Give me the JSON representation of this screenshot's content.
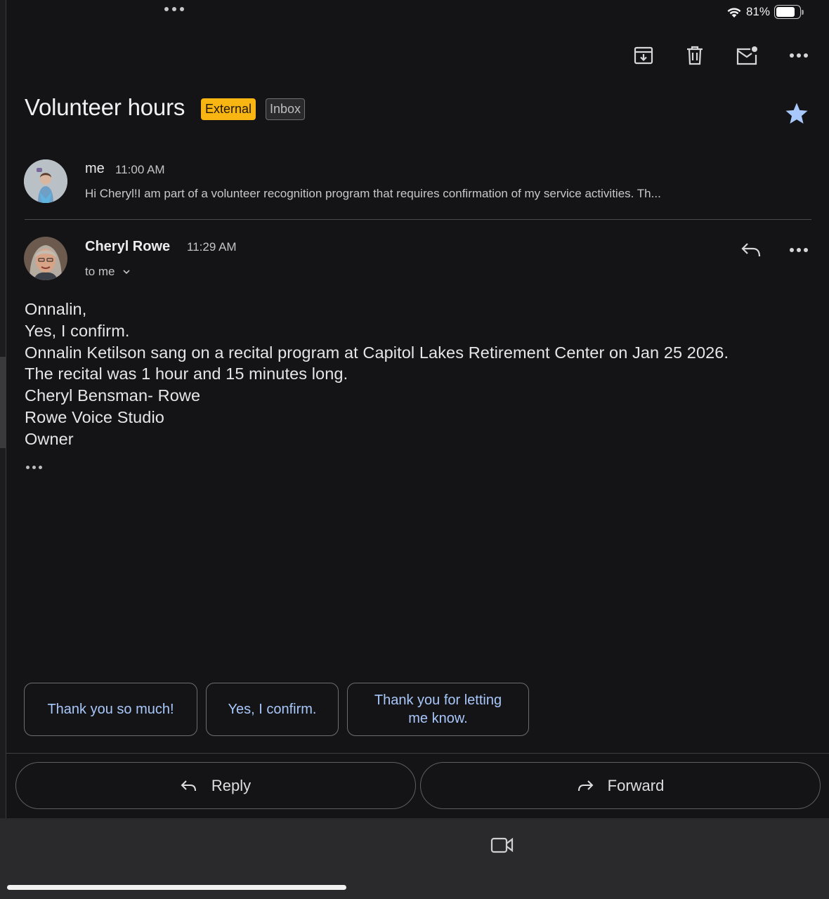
{
  "status": {
    "battery": "81%",
    "battery_level": 0.81
  },
  "toolbar": {
    "archive_icon": "archive-icon",
    "delete_icon": "trash-icon",
    "unread_icon": "mark-unread-icon",
    "more_icon": "more-horizontal-icon"
  },
  "thread": {
    "subject": "Volunteer hours",
    "labels": [
      "External",
      "Inbox"
    ],
    "starred": true
  },
  "messages": [
    {
      "sender": "me",
      "time": "11:00 AM",
      "snippet": "Hi Cheryl!I am part of a volunteer recognition program that requires confirmation of my service activities. Th..."
    },
    {
      "sender": "Cheryl Rowe",
      "time": "11:29 AM",
      "to": "to me",
      "body": [
        "Onnalin,",
        "Yes, I confirm.",
        "Onnalin Ketilson sang on a recital program at Capitol Lakes Retirement Center on Jan 25 2026.",
        "The recital was 1 hour and 15 minutes long.",
        "Cheryl Bensman- Rowe",
        "Rowe Voice Studio",
        "Owner"
      ]
    }
  ],
  "smart_replies": [
    "Thank you so much!",
    "Yes, I confirm.",
    "Thank you for letting me know."
  ],
  "actions": {
    "reply": "Reply",
    "forward": "Forward"
  },
  "colors": {
    "background": "#141416",
    "accent_blue": "#a8c7fa",
    "external_badge": "#f9b512",
    "star": "#a8c7fa"
  }
}
